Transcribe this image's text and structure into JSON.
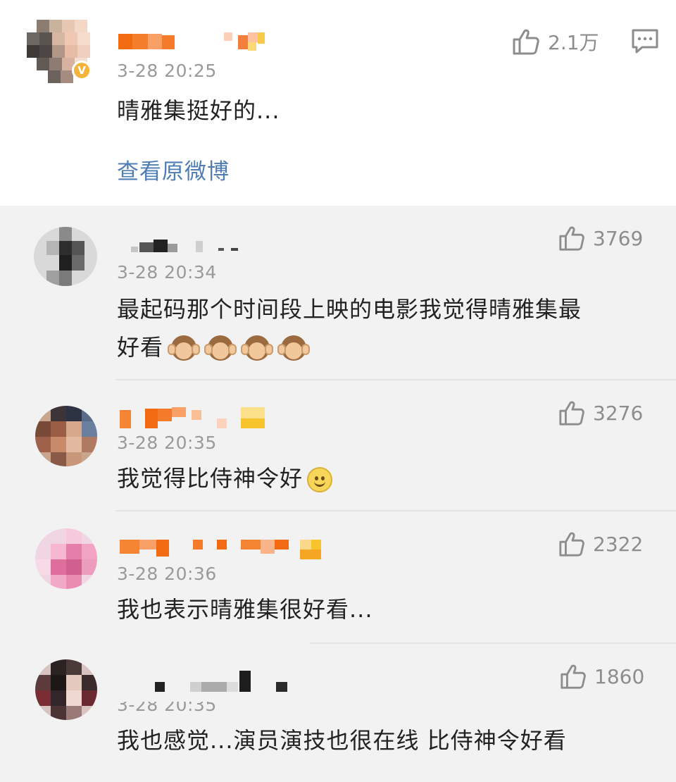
{
  "original_post": {
    "timestamp": "3-28 20:25",
    "text": "晴雅集挺好的...",
    "likes": "2.1万",
    "view_original_label": "查看原微博",
    "verified_badge": "V",
    "icons": {
      "like": "thumbs-up-icon",
      "reply": "comment-icon"
    }
  },
  "comments": [
    {
      "timestamp": "3-28 20:34",
      "text_line1": "最起码那个时间段上映的电影我觉得晴雅集最",
      "text_line2": "好看",
      "likes": "3769",
      "emoji": "see-no-evil-monkey-icon x4"
    },
    {
      "timestamp": "3-28 20:35",
      "text": "我觉得比侍神令好",
      "likes": "3276",
      "emoji": "smiley-icon"
    },
    {
      "timestamp": "3-28 20:36",
      "text": "我也表示晴雅集很好看...",
      "likes": "2322"
    },
    {
      "timestamp": "3-28 20:35",
      "text": "我也感觉...演员演技也很在线 比侍神令好看",
      "likes": "1860"
    }
  ],
  "colors": {
    "background": "#f2f2f2",
    "card": "#ffffff",
    "link": "#4f7db3",
    "meta": "#9a9a9a",
    "verified": "#f4b33a"
  }
}
